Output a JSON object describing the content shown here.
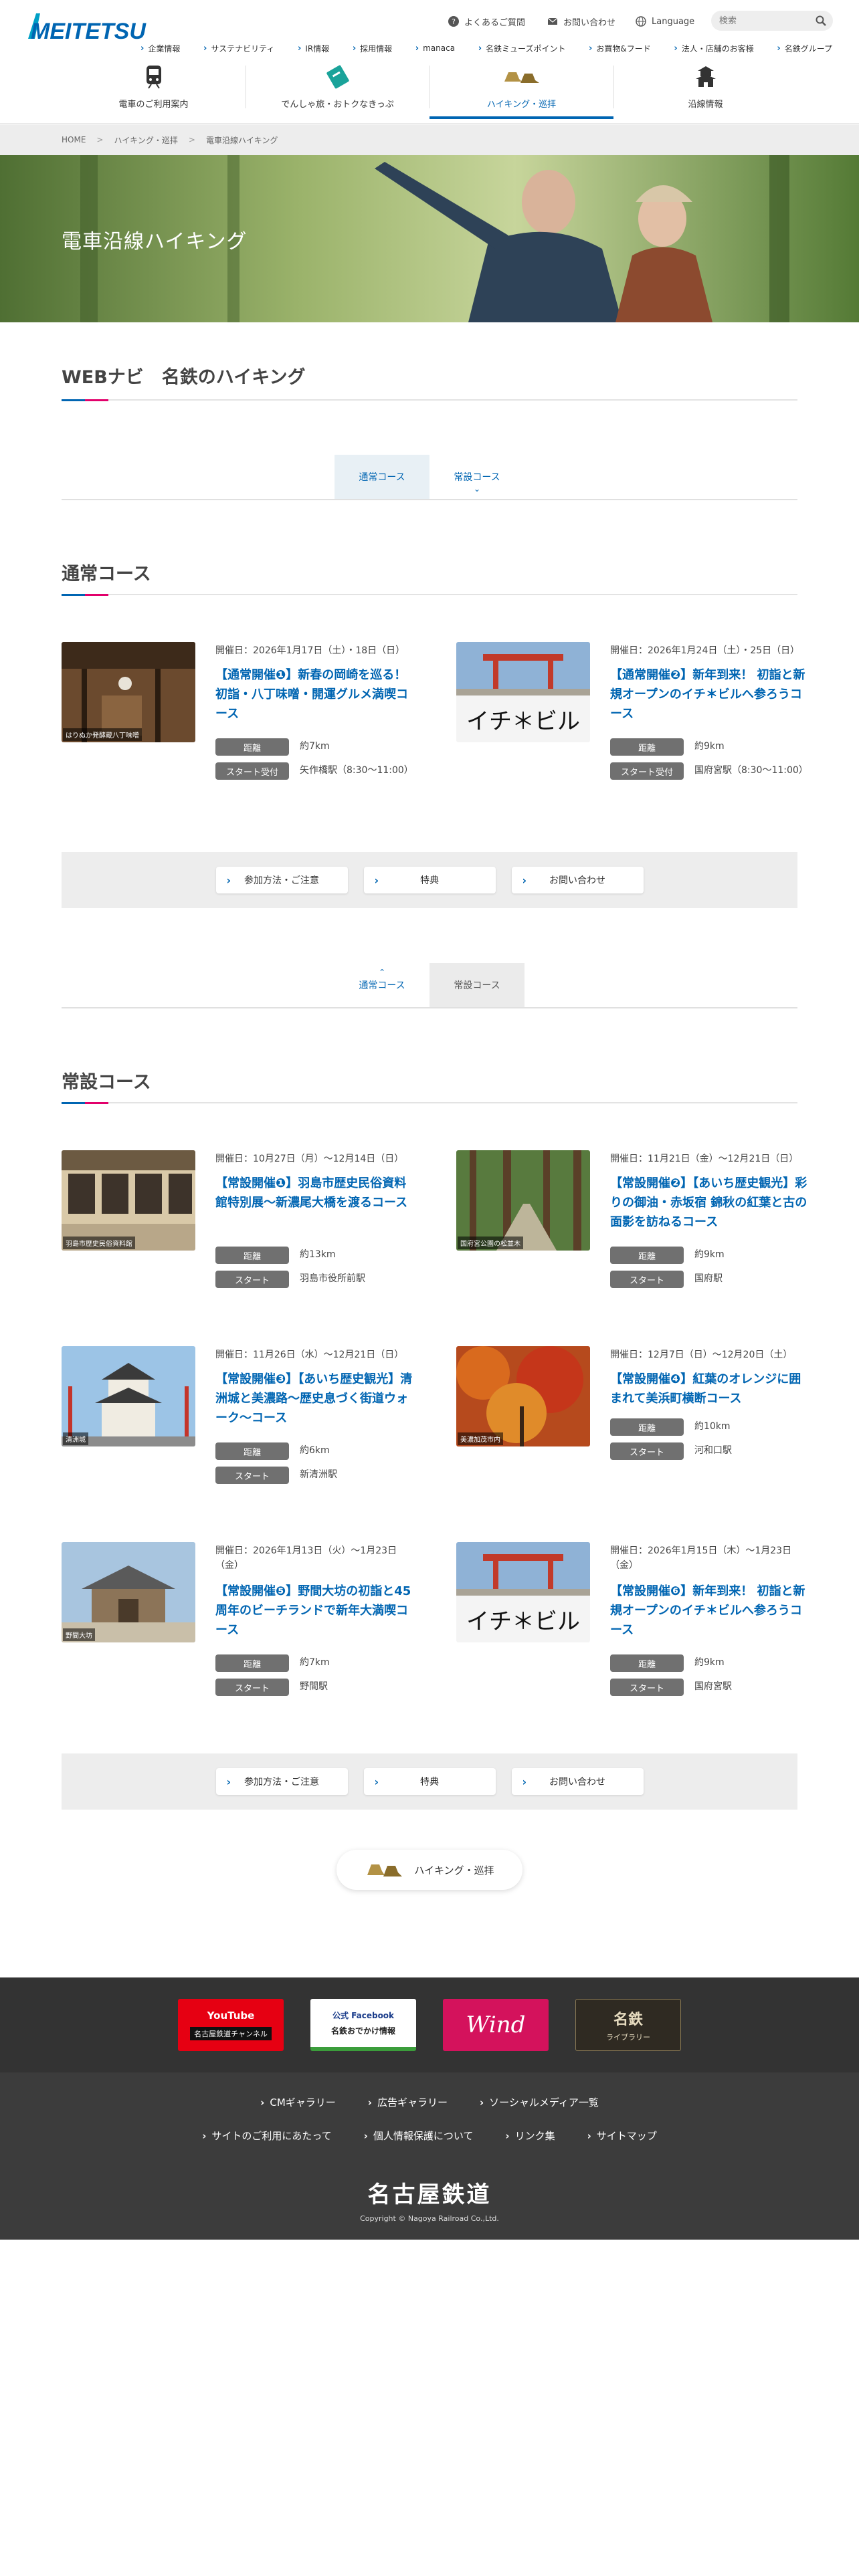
{
  "header": {
    "logo_text": "MEITETSU",
    "util_links": [
      "よくあるご質問",
      "お問い合わせ",
      "Language"
    ],
    "search_placeholder": "検索",
    "sub_links": [
      "企業情報",
      "サステナビリティ",
      "IR情報",
      "採用情報",
      "manaca",
      "名鉄ミューズポイント",
      "お買物&フード",
      "法人・店舗のお客様",
      "名鉄グループ"
    ],
    "main_nav": [
      "電車のご利用案内",
      "でんしゃ旅・おトクなきっぷ",
      "ハイキング・巡拝",
      "沿線情報"
    ]
  },
  "breadcrumb": [
    "HOME",
    "ハイキング・巡拝",
    "電車沿線ハイキング"
  ],
  "hero": {
    "title": "電車沿線ハイキング"
  },
  "page_title": "WEBナビ　名鉄のハイキング",
  "tabs": {
    "normal": "通常コース",
    "permanent": "常設コース"
  },
  "labels": {
    "distance": "距離",
    "start_reception": "スタート受付",
    "start": "スタート"
  },
  "normal_section": {
    "title": "通常コース",
    "cards": [
      {
        "thumb_tag": "はりぬか発酵蔵八丁味噌",
        "date": "開催日：2026年1月17日（土）・18日（日）",
        "title": "【通常開催❶】新春の岡崎を巡る！ 初詣・八丁味噌・開運グルメ満喫コース",
        "distance": "約7km",
        "start": "矢作橋駅（8:30〜11:00）"
      },
      {
        "thumb_tag": "",
        "thumb_text": "イチ＊ビル",
        "date": "開催日：2026年1月24日（土）・25日（日）",
        "title": "【通常開催❷】新年到来！ 初詣と新規オープンのイチ＊ビルへ参ろうコース",
        "distance": "約9km",
        "start": "国府宮駅（8:30〜11:00）"
      }
    ]
  },
  "info_buttons": [
    "参加方法・ご注意",
    "特典",
    "お問い合わせ"
  ],
  "permanent_section": {
    "title": "常設コース",
    "cards": [
      {
        "thumb_tag": "羽島市歴史民俗資料館",
        "date": "開催日：10月27日（月）〜12月14日（日）",
        "title": "【常設開催❶】羽島市歴史民俗資料館特別展〜新濃尾大橋を渡るコース",
        "distance": "約13km",
        "start": "羽島市役所前駅"
      },
      {
        "thumb_tag": "国府宮公園の松並木",
        "date": "開催日：11月21日（金）〜12月21日（日）",
        "title": "【常設開催❷】【あいち歴史観光】彩りの御油・赤坂宿 錦秋の紅葉と古の面影を訪ねるコース",
        "distance": "約9km",
        "start": "国府駅"
      },
      {
        "thumb_tag": "清洲城",
        "date": "開催日：11月26日（水）〜12月21日（日）",
        "title": "【常設開催❸】【あいち歴史観光】清洲城と美濃路〜歴史息づく街道ウォーク〜コース",
        "distance": "約6km",
        "start": "新清洲駅"
      },
      {
        "thumb_tag": "美濃加茂市内",
        "date": "開催日：12月7日（日）〜12月20日（土）",
        "title": "【常設開催❹】紅葉のオレンジに囲まれて美浜町横断コース",
        "distance": "約10km",
        "start": "河和口駅"
      },
      {
        "thumb_tag": "野間大坊",
        "date": "開催日：2026年1月13日（火）〜1月23日（金）",
        "title": "【常設開催❺】野間大坊の初詣と45周年のビーチランドで新年大満喫コース",
        "distance": "約7km",
        "start": "野間駅"
      },
      {
        "thumb_tag": "",
        "thumb_text": "イチ＊ビル",
        "date": "開催日：2026年1月15日（木）〜1月23日（金）",
        "title": "【常設開催❻】新年到来！ 初詣と新規オープンのイチ＊ビルへ参ろうコース",
        "distance": "約9km",
        "start": "国府宮駅"
      }
    ]
  },
  "back_pill": "ハイキング・巡拝",
  "footer": {
    "banners": {
      "youtube": [
        "YouTube",
        "名古屋鉄道チャンネル"
      ],
      "facebook": [
        "公式 Facebook",
        "名鉄おでかけ情報"
      ],
      "wind": "Wind",
      "library": [
        "名鉄",
        "ライブラリー"
      ]
    },
    "links_row1": [
      "CMギャラリー",
      "広告ギャラリー",
      "ソーシャルメディア一覧"
    ],
    "links_row2": [
      "サイトのご利用にあたって",
      "個人情報保護について",
      "リンク集",
      "サイトマップ"
    ],
    "brand": "名古屋鉄道",
    "copyright": "Copyright © Nagoya Railroad Co.,Ltd."
  },
  "colors": {
    "brand_blue": "#0065b2",
    "accent_pink": "#e2006b",
    "label_gray": "#707070"
  }
}
